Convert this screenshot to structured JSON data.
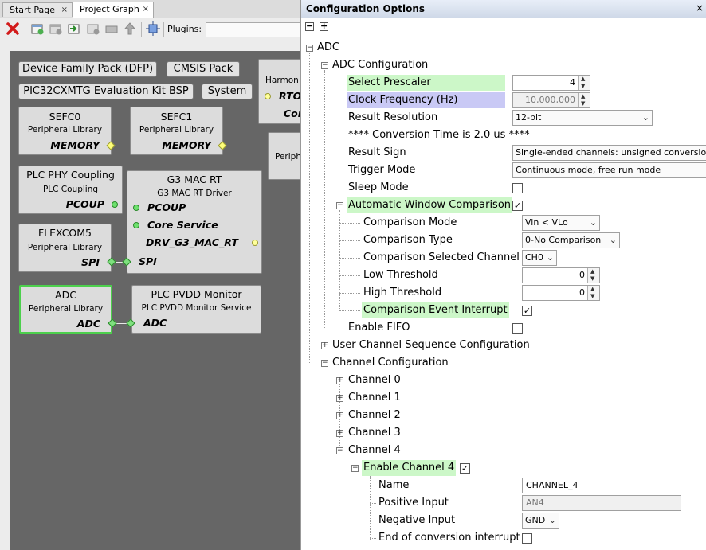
{
  "tabs": [
    {
      "label": "Start Page",
      "close": "×"
    },
    {
      "label": "Project Graph",
      "close": "×"
    }
  ],
  "toolbar": {
    "icons": [
      "delete-icon",
      "new-component-icon",
      "save-icon",
      "import-icon",
      "export-icon",
      "print-icon",
      "move-up-icon",
      "auto-arrange-icon"
    ],
    "plugins_label": "Plugins:",
    "plugins_value": ""
  },
  "graph": {
    "pills": {
      "dfp": "Device Family Pack (DFP)",
      "cmsis": "CMSIS Pack",
      "bsp": "PIC32CXMTG Evaluation Kit BSP",
      "system": "System"
    },
    "harmony": {
      "title": "Harmon",
      "port": "RTO",
      "sub": "Cor"
    },
    "periph_cut": "Periph",
    "sefc0": {
      "title": "SEFC0",
      "sub": "Peripheral Library",
      "port": "MEMORY"
    },
    "sefc1": {
      "title": "SEFC1",
      "sub": "Peripheral Library",
      "port": "MEMORY"
    },
    "plcphy": {
      "title": "PLC PHY Coupling",
      "sub": "PLC Coupling",
      "port": "PCOUP"
    },
    "g3mac": {
      "title": "G3 MAC RT",
      "sub": "G3 MAC RT Driver",
      "port1": "PCOUP",
      "port2": "Core Service",
      "port3": "DRV_G3_MAC_RT",
      "port4": "SPI"
    },
    "flexcom5": {
      "title": "FLEXCOM5",
      "sub": "Peripheral Library",
      "port": "SPI"
    },
    "adc": {
      "title": "ADC",
      "sub": "Peripheral Library",
      "port": "ADC"
    },
    "pvdd": {
      "title": "PLC PVDD Monitor",
      "sub": "PLC PVDD Monitor Service",
      "port": "ADC"
    }
  },
  "config": {
    "title": "Configuration Options",
    "close": "×",
    "collapse_all": "−",
    "expand_all": "+",
    "root": "ADC",
    "adc_configuration": "ADC Configuration",
    "select_prescaler": {
      "label": "Select Prescaler",
      "value": "4"
    },
    "clock_frequency": {
      "label": "Clock Frequency (Hz)",
      "value": "10,000,000"
    },
    "result_resolution": {
      "label": "Result Resolution",
      "value": "12-bit"
    },
    "conversion_time": "**** Conversion Time is 2.0 us ****",
    "result_sign": {
      "label": "Result Sign",
      "value": "Single-ended channels: unsigned conversions Diffe"
    },
    "trigger_mode": {
      "label": "Trigger Mode",
      "value": "Continuous mode, free run mode"
    },
    "sleep_mode": {
      "label": "Sleep Mode",
      "checked": false
    },
    "awc": {
      "label": "Automatic Window Comparison",
      "checked": true
    },
    "comparison_mode": {
      "label": "Comparison Mode",
      "value": "Vin < VLo"
    },
    "comparison_type": {
      "label": "Comparison Type",
      "value": "0-No Comparison"
    },
    "comparison_channel": {
      "label": "Comparison Selected Channel",
      "value": "CH0"
    },
    "low_threshold": {
      "label": "Low Threshold",
      "value": "0"
    },
    "high_threshold": {
      "label": "High Threshold",
      "value": "0"
    },
    "comparison_interrupt": {
      "label": "Comparison Event Interrupt",
      "checked": true
    },
    "enable_fifo": {
      "label": "Enable FIFO",
      "checked": false
    },
    "user_channel_seq": "User Channel Sequence Configuration",
    "channel_configuration": "Channel Configuration",
    "channels": [
      "Channel 0",
      "Channel 1",
      "Channel 2",
      "Channel 3",
      "Channel 4"
    ],
    "enable_channel4": {
      "label": "Enable Channel 4",
      "checked": true
    },
    "name": {
      "label": "Name",
      "value": "CHANNEL_4"
    },
    "positive_input": {
      "label": "Positive Input",
      "value": "AN4"
    },
    "negative_input": {
      "label": "Negative Input",
      "value": "GND"
    },
    "eoc_interrupt": {
      "label": "End of conversion interrupt",
      "checked": false
    }
  },
  "colors": {
    "highlight_green": "#ccf7c8",
    "highlight_purple": "#c9c9f5",
    "canvas": "#666666",
    "selected_border": "#4cd04c"
  }
}
